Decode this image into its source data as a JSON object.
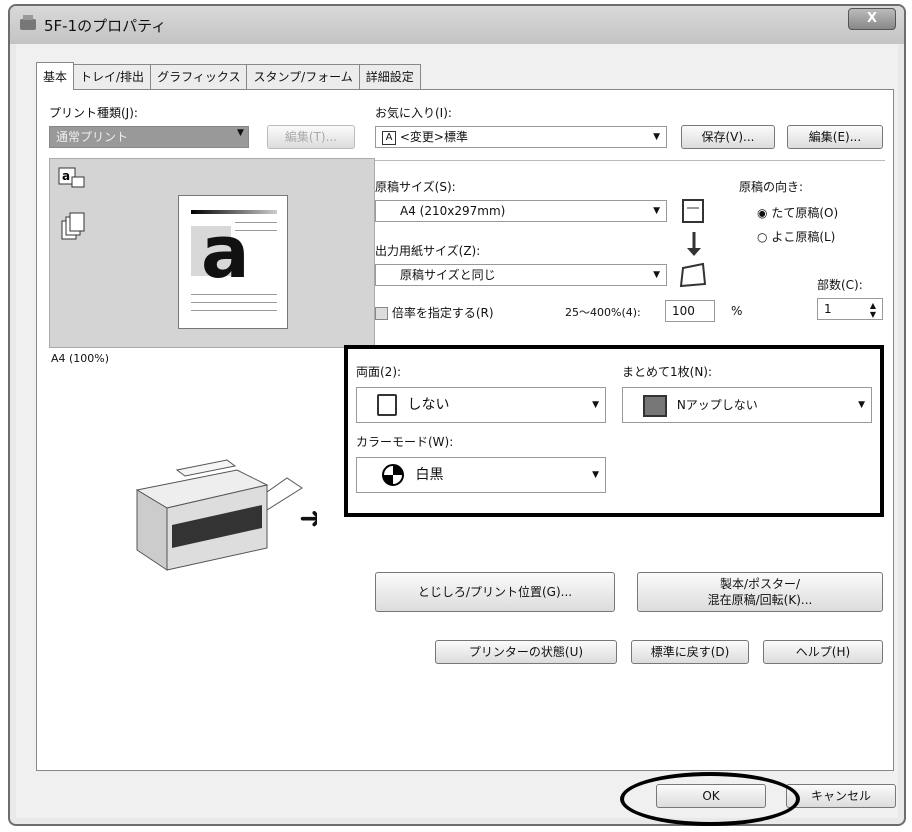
{
  "window": {
    "title": "5F-1のプロパティ",
    "close_label": "X"
  },
  "tabs": [
    "基本",
    "トレイ/排出",
    "グラフィックス",
    "スタンプ/フォーム",
    "詳細設定"
  ],
  "left": {
    "print_type_label": "プリント種類(J):",
    "print_type_value": "通常プリント",
    "edit_button": "編集(T)...",
    "preview_caption": "A4 (100%)",
    "preview_letter": "a"
  },
  "favorites": {
    "label": "お気に入り(I):",
    "value": "<変更>標準",
    "badge": "A",
    "save_button": "保存(V)...",
    "edit_button": "編集(E)..."
  },
  "paper": {
    "original_size_label": "原稿サイズ(S):",
    "original_size_value": "A4 (210x297mm)",
    "output_size_label": "出力用紙サイズ(Z):",
    "output_size_value": "原稿サイズと同じ",
    "orientation_label": "原稿の向き:",
    "portrait": "たて原稿(O)",
    "landscape": "よこ原稿(L)",
    "copies_label": "部数(C):",
    "copies_value": "1",
    "scale_check": "倍率を指定する(R)",
    "scale_range": "25〜400%(4):",
    "scale_value": "100",
    "scale_unit": "%"
  },
  "highlight": {
    "duplex_label": "両面(2):",
    "duplex_value": "しない",
    "nup_label": "まとめて1枚(N):",
    "nup_value": "Nアップしない",
    "color_label": "カラーモード(W):",
    "color_value": "白黒"
  },
  "buttons": {
    "binding": "とじしろ/プリント位置(G)...",
    "booklet_line1": "製本/ポスター/",
    "booklet_line2": "混在原稿/回転(K)...",
    "printer_status": "プリンターの状態(U)",
    "defaults": "標準に戻す(D)",
    "help": "ヘルプ(H)",
    "ok": "OK",
    "cancel": "キャンセル"
  }
}
